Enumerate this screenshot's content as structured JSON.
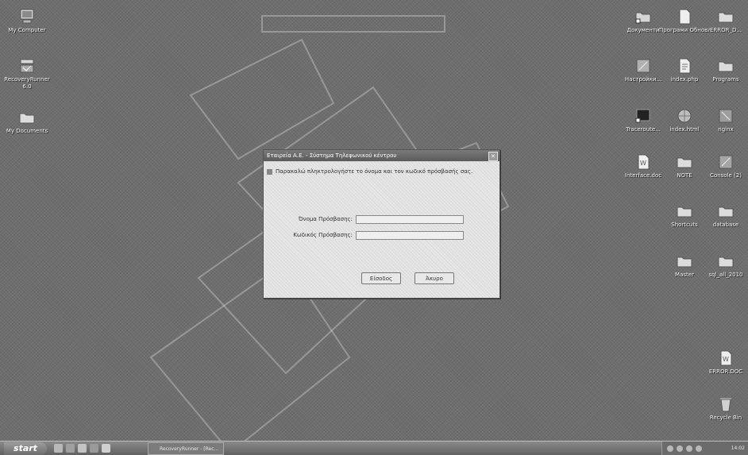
{
  "desktop": {
    "icons_left": [
      {
        "label": "My Computer",
        "icon": "computer-icon"
      },
      {
        "label": "RecoveryRunner",
        "label2": "6.0",
        "icon": "application-icon"
      },
      {
        "label": "My Documents",
        "icon": "folder-icon"
      }
    ],
    "icons_right": [
      {
        "label": "Документи",
        "icon": "shortcut-icon"
      },
      {
        "label": "Програми Обновления",
        "icon": "document-icon"
      },
      {
        "label": "ERROR_D...",
        "icon": "folder-icon"
      },
      {
        "label": "Настройки...",
        "icon": "application-icon"
      },
      {
        "label": "index.php",
        "icon": "document-icon"
      },
      {
        "label": "Programs",
        "icon": "folder-icon"
      },
      {
        "label": "Traceroute...",
        "icon": "shortcut-icon"
      },
      {
        "label": "index.html",
        "icon": "globe-icon"
      },
      {
        "label": "nginx",
        "icon": "application-icon"
      },
      {
        "label": "Interface.doc",
        "icon": "word-document-icon"
      },
      {
        "label": "NOTE",
        "icon": "folder-icon"
      },
      {
        "label": "Console (2)",
        "icon": "application-icon"
      },
      {
        "label": "Shortcuts",
        "icon": "folder-icon"
      },
      {
        "label": "database",
        "icon": "folder-icon"
      },
      {
        "label": "Master",
        "icon": "folder-icon"
      },
      {
        "label": "sql_all_2010",
        "icon": "folder-icon"
      },
      {
        "label": "ERROR.DOC",
        "icon": "word-document-icon"
      },
      {
        "label": "Recycle Bin",
        "icon": "recycle-bin-icon"
      }
    ]
  },
  "dialog": {
    "title": "Εταιρεία Α.Ε. - Σύστημα Τηλεφωνικού κέντρου",
    "close_symbol": "✕",
    "prompt": "Παρακαλώ πληκτρολογήστε το όνομα και τον κωδικό πρόσβασής σας.",
    "username_label": "Όνομα Πρόσβασης:",
    "username_value": "",
    "password_label": "Κωδικός Πρόσβασης:",
    "password_value": "",
    "ok_label": "Είσοδος",
    "cancel_label": "Άκυρο"
  },
  "taskbar": {
    "start_label": "start",
    "task_label": "RecoveryRunner - [Rec...",
    "clock": "14:02"
  },
  "colors": {
    "desktop_bg": "#6e6e6e",
    "titlebar": "#6a6a6a",
    "taskbar": "#737373"
  }
}
